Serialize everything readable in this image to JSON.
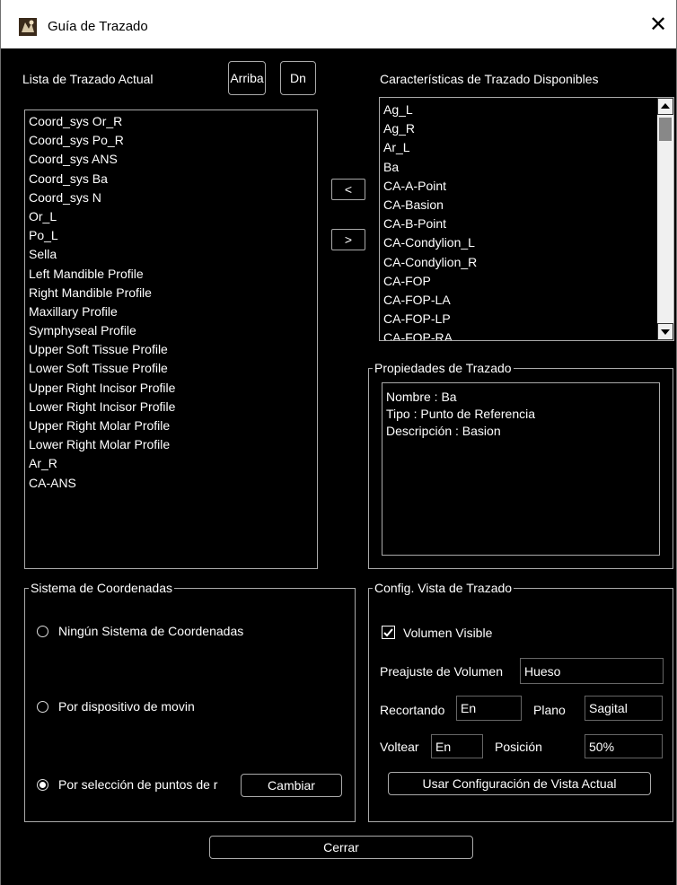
{
  "window": {
    "title": "Guía de Trazado",
    "close_symbol": "✕"
  },
  "current_list": {
    "label": "Lista de Trazado Actual",
    "up_button": "Arriba",
    "down_button": "Dn",
    "items": [
      "Coord_sys Or_R",
      "Coord_sys Po_R",
      "Coord_sys ANS",
      "Coord_sys Ba",
      "Coord_sys N",
      "Or_L",
      "Po_L",
      "Sella",
      "Left Mandible Profile",
      "Right Mandible Profile",
      "Maxillary Profile",
      "Symphyseal Profile",
      "Upper Soft Tissue Profile",
      "Lower Soft Tissue Profile",
      "Upper Right Incisor Profile",
      "Lower Right Incisor Profile",
      "Upper Right Molar Profile",
      "Lower Right Molar Profile",
      "Ar_R",
      "CA-ANS"
    ]
  },
  "transfer": {
    "add_left": "<",
    "move_right": ">"
  },
  "available_list": {
    "label": "Características de Trazado Disponibles",
    "items": [
      "Ag_L",
      "Ag_R",
      "Ar_L",
      "Ba",
      "CA-A-Point",
      "CA-Basion",
      "CA-B-Point",
      "CA-Condylion_L",
      "CA-Condylion_R",
      "CA-FOP",
      "CA-FOP-LA",
      "CA-FOP-LP",
      "CA-FOP-RA"
    ]
  },
  "properties": {
    "title": "Propiedades de Trazado",
    "lines": [
      "Nombre : Ba",
      "Tipo : Punto de Referencia",
      "Descripción : Basion"
    ]
  },
  "coord_system": {
    "title": "Sistema de Coordenadas",
    "options": [
      {
        "label": "Ningún Sistema de Coordenadas",
        "selected": false
      },
      {
        "label": "Por dispositivo de movin",
        "selected": false
      },
      {
        "label": "Por selección de puntos de r",
        "selected": true
      }
    ],
    "change_button": "Cambiar"
  },
  "view_config": {
    "title": "Config. Vista de Trazado",
    "volume_visible_label": "Volumen Visible",
    "volume_visible_checked": true,
    "preset_label": "Preajuste de Volumen",
    "preset_value": "Hueso",
    "crop_label": "Recortando",
    "crop_value": "En",
    "plane_label": "Plano",
    "plane_value": "Sagital",
    "flip_label": "Voltear",
    "flip_value": "En",
    "position_label": "Posición",
    "position_value": "50%",
    "use_current_button": "Usar Configuración de Vista Actual"
  },
  "footer": {
    "close_button": "Cerrar"
  }
}
